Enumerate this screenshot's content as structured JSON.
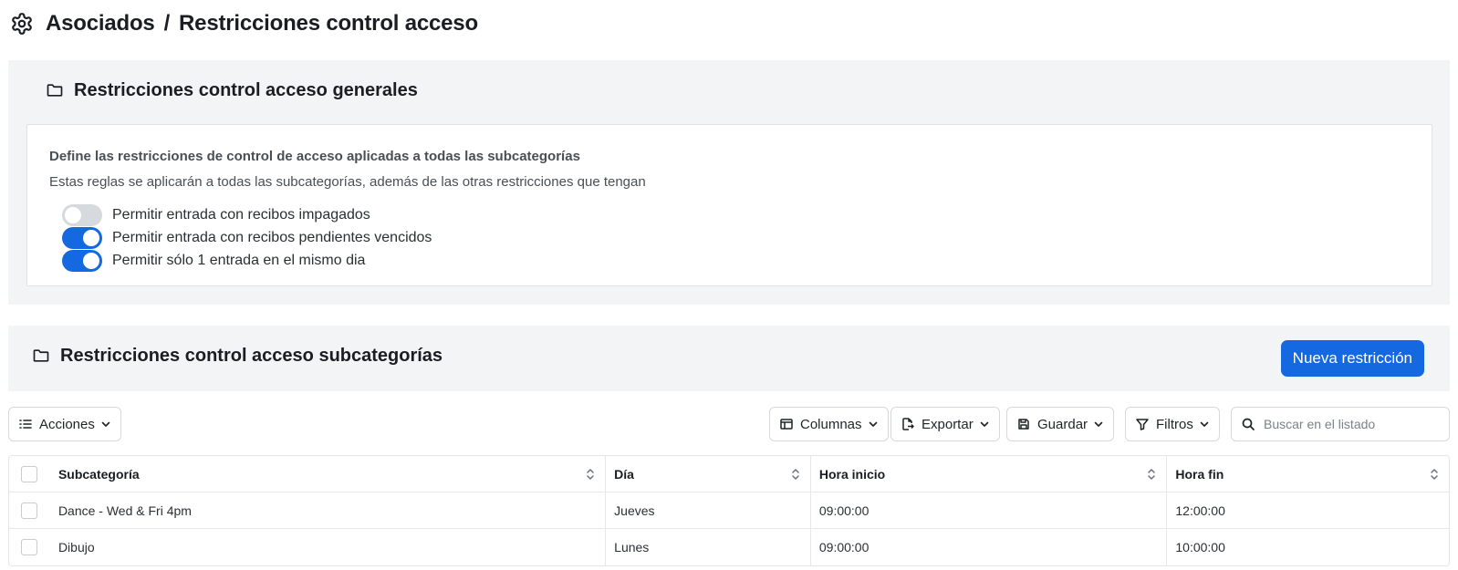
{
  "header": {
    "icon": "gear-icon",
    "section": "Asociados",
    "separator": "/",
    "title": "Restricciones control acceso"
  },
  "general": {
    "title": "Restricciones control acceso generales",
    "card_title": "Define las restricciones de control de acceso aplicadas a todas las subcategorías",
    "card_desc": "Estas reglas se aplicarán a todas las subcategorías, además de las otras restricciones que tengan",
    "toggles": [
      {
        "label": "Permitir entrada con recibos impagados",
        "on": false
      },
      {
        "label": "Permitir entrada con recibos pendientes vencidos",
        "on": true
      },
      {
        "label": "Permitir sólo 1 entrada en el mismo dia",
        "on": true
      }
    ]
  },
  "subcategorias": {
    "title": "Restricciones control acceso subcategorías",
    "new_button": "Nueva restricción"
  },
  "toolbar": {
    "acciones": "Acciones",
    "columnas": "Columnas",
    "exportar": "Exportar",
    "guardar": "Guardar",
    "filtros": "Filtros",
    "search_placeholder": "Buscar en el listado"
  },
  "table": {
    "columns": [
      "Subcategoría",
      "Día",
      "Hora inicio",
      "Hora fin"
    ],
    "rows": [
      [
        "Dance - Wed & Fri 4pm",
        "Jueves",
        "09:00:00",
        "12:00:00"
      ],
      [
        "Dibujo",
        "Lunes",
        "09:00:00",
        "10:00:00"
      ]
    ]
  },
  "colors": {
    "primary": "#1469e0",
    "panel_bg": "#f3f4f6",
    "toggle_off": "#d6d9dd"
  }
}
